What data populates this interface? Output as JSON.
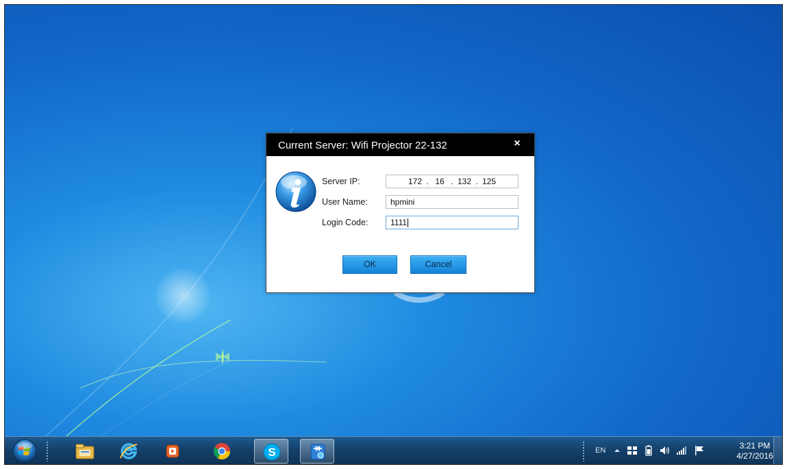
{
  "dialog": {
    "title": "Current Server: Wifi Projector 22-132",
    "close_label": "×",
    "fields": {
      "server_ip_label": "Server IP:",
      "server_ip_parts": [
        "172",
        "16",
        "132",
        "125"
      ],
      "ip_separator": ".",
      "user_name_label": "User Name:",
      "user_name_value": "hpmini",
      "login_code_label": "Login Code:",
      "login_code_value": "1111"
    },
    "ok_label": "OK",
    "cancel_label": "Cancel",
    "icon": "info-icon"
  },
  "taskbar": {
    "items": [
      "file-explorer-icon",
      "internet-explorer-icon",
      "media-player-icon",
      "chrome-icon",
      "skype-icon",
      "projector-app-icon"
    ],
    "active_item": "projector-app-icon",
    "tray": {
      "language": "EN",
      "icons": [
        "show-hidden-icons-chevron",
        "network-app-icon",
        "battery-icon",
        "volume-icon",
        "signal-icon",
        "action-center-flag-icon"
      ]
    },
    "clock_time": "3:21 PM",
    "clock_date": "4/27/2016"
  },
  "colors": {
    "desktop_blue": "#1268c9",
    "titlebar": "#000000",
    "button_blue": "#1582d6",
    "taskbar": "#14406a"
  }
}
